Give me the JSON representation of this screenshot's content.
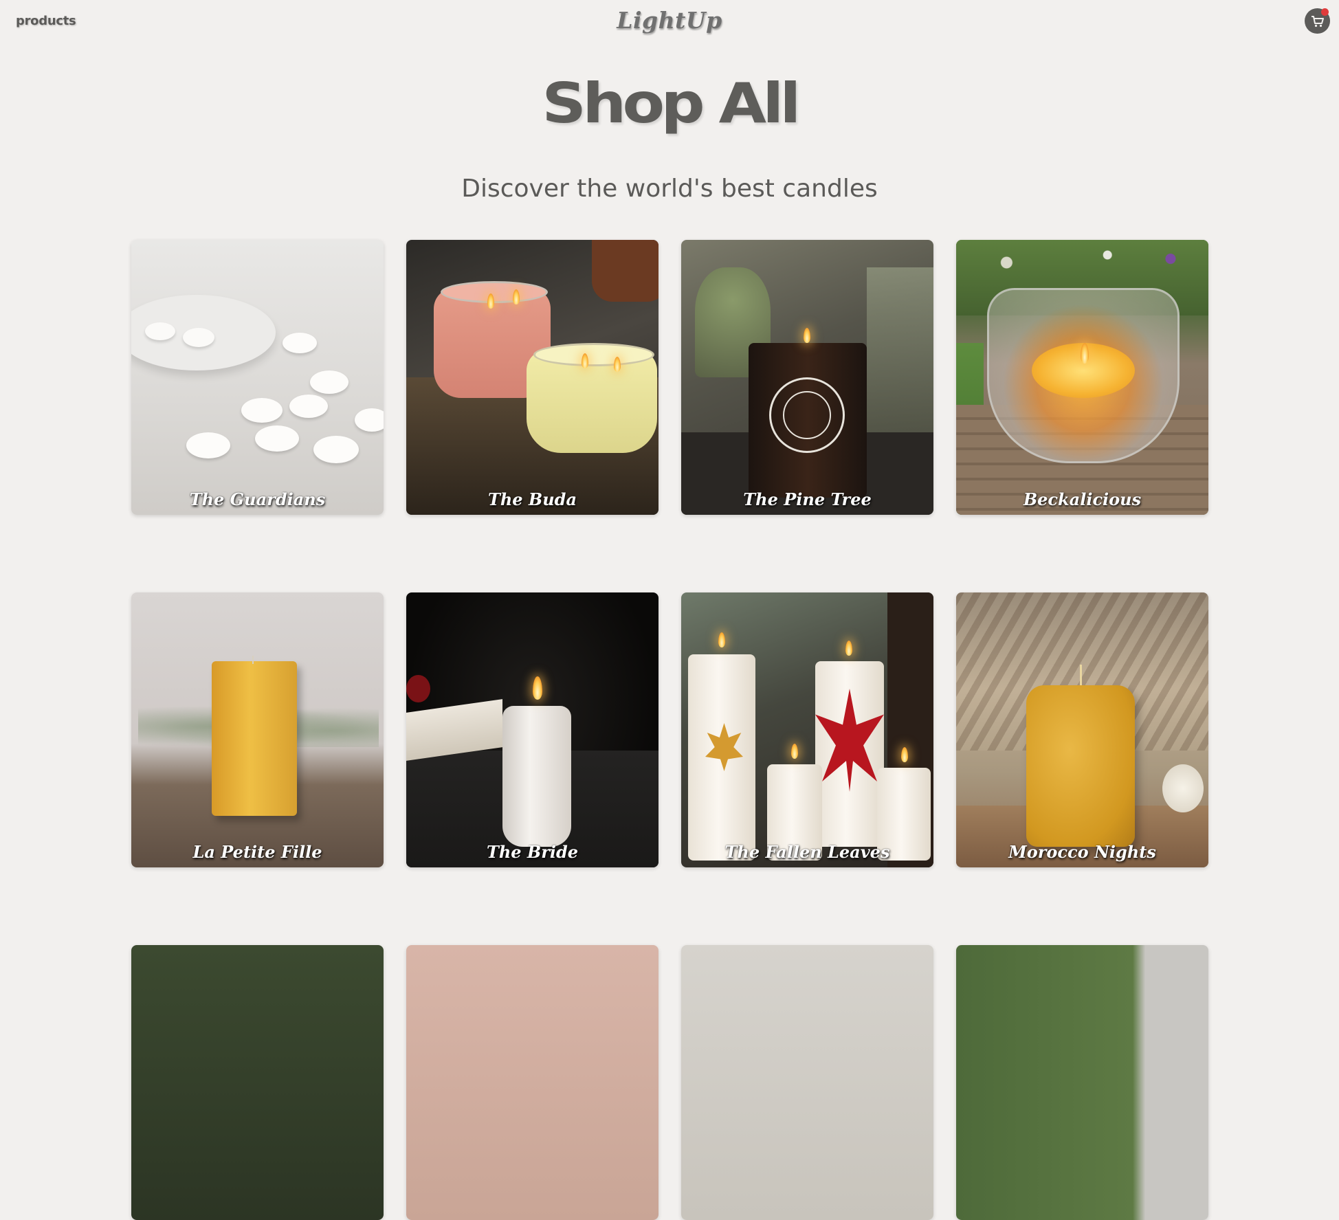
{
  "header": {
    "nav_link": "products",
    "logo": "LightUp",
    "cart_icon": "cart-icon"
  },
  "hero": {
    "title": "Shop All",
    "subtitle": "Discover the world's best candles"
  },
  "products": [
    {
      "name": "The Guardians"
    },
    {
      "name": "The Buda"
    },
    {
      "name": "The Pine Tree"
    },
    {
      "name": "Beckalicious"
    },
    {
      "name": "La Petite Fille"
    },
    {
      "name": "The Bride"
    },
    {
      "name": "The Fallen Leaves"
    },
    {
      "name": "Morocco Nights"
    }
  ],
  "colors": {
    "background": "#f2f0ee",
    "text": "#5b5a58",
    "cart_badge": "#e03b3b"
  }
}
